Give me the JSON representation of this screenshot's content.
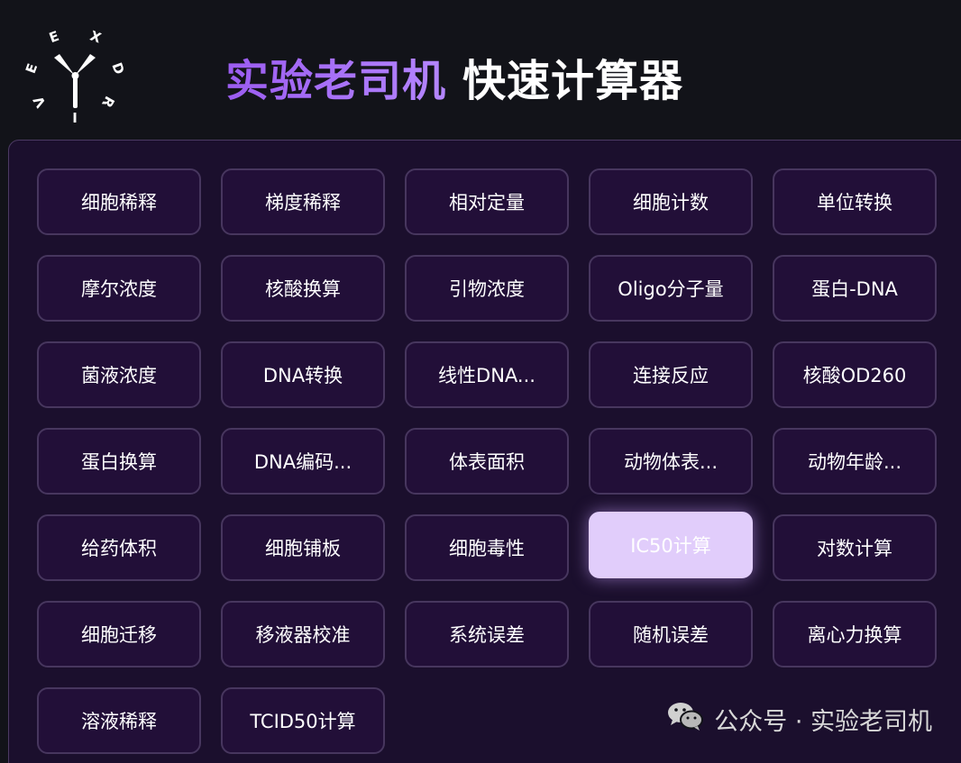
{
  "logo": {
    "letters": [
      "E",
      "X",
      "D",
      "R",
      "I",
      "V",
      "E"
    ],
    "icon": "windmill-logo-icon"
  },
  "header": {
    "title_accent": "实验老司机",
    "title_main": "快速计算器"
  },
  "calculators": [
    {
      "label": "细胞稀释"
    },
    {
      "label": "梯度稀释"
    },
    {
      "label": "相对定量"
    },
    {
      "label": "细胞计数"
    },
    {
      "label": "单位转换"
    },
    {
      "label": "摩尔浓度"
    },
    {
      "label": "核酸换算"
    },
    {
      "label": "引物浓度"
    },
    {
      "label": "Oligo分子量"
    },
    {
      "label": "蛋白-DNA"
    },
    {
      "label": "菌液浓度"
    },
    {
      "label": "DNA转换"
    },
    {
      "label": "线性DNA..."
    },
    {
      "label": "连接反应"
    },
    {
      "label": "核酸OD260"
    },
    {
      "label": "蛋白换算"
    },
    {
      "label": "DNA编码..."
    },
    {
      "label": "体表面积"
    },
    {
      "label": "动物体表..."
    },
    {
      "label": "动物年龄..."
    },
    {
      "label": "给药体积"
    },
    {
      "label": "细胞铺板"
    },
    {
      "label": "细胞毒性"
    },
    {
      "label": "IC50计算",
      "active": true
    },
    {
      "label": "对数计算"
    },
    {
      "label": "细胞迁移"
    },
    {
      "label": "移液器校准"
    },
    {
      "label": "系统误差"
    },
    {
      "label": "随机误差"
    },
    {
      "label": "离心力换算"
    },
    {
      "label": "溶液稀释"
    },
    {
      "label": "TCID50计算"
    }
  ],
  "watermark": {
    "text": "公众号 · 实验老司机",
    "icon": "wechat-icon"
  },
  "colors": {
    "background": "#121319",
    "panel": "#1b0f2d",
    "button": "#220f38",
    "button_border": "#47365e",
    "active_button": "#e1cdfb",
    "title_accent": "#a46cf5"
  }
}
